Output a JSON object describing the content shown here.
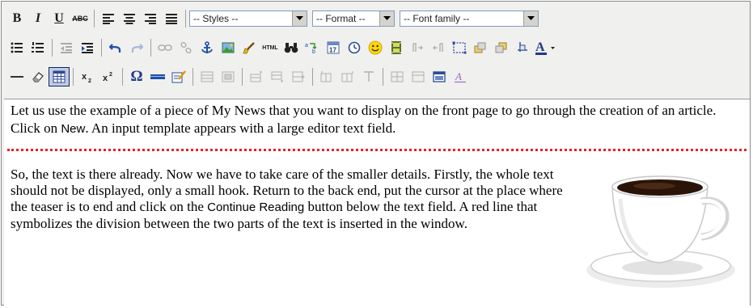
{
  "toolbar": {
    "row1": {
      "bold_label": "B",
      "italic_label": "I",
      "underline_label": "U",
      "strike_label": "ABC",
      "styles_value": "-- Styles --",
      "format_value": "-- Format --",
      "font_family_value": "-- Font family --"
    },
    "row2": {
      "html_label": "HTML",
      "date_label": "17"
    },
    "row3": {
      "omega_label": "Ω"
    }
  },
  "editor": {
    "paragraph1_a": "Let us use the example of a piece of My News that you want to display on the front page to go through the creation of an article. Click on ",
    "paragraph1_button": "New",
    "paragraph1_b": ". An input template appears with a large editor text field.",
    "paragraph2_a": "So, the text is there already. Now we have to take care of the smaller details. Firstly, the whole text should not be displayed, only a small hook. Return to the back end, put the cursor at the place where the teaser is to end and click on the ",
    "paragraph2_button": "Continue Reading",
    "paragraph2_b": " button below the text field. A red line that symbolizes the division between the two parts of the text is inserted in the window."
  },
  "icons": {
    "undo": "undo-icon",
    "redo": "redo-icon",
    "smiley": "smiley-icon",
    "image": "image-icon",
    "anchor": "anchor-icon"
  },
  "colors": {
    "toolbar_bg": "#f0f0ee",
    "readmore_line": "#e8202a",
    "active_button": "#c2cbe0"
  }
}
